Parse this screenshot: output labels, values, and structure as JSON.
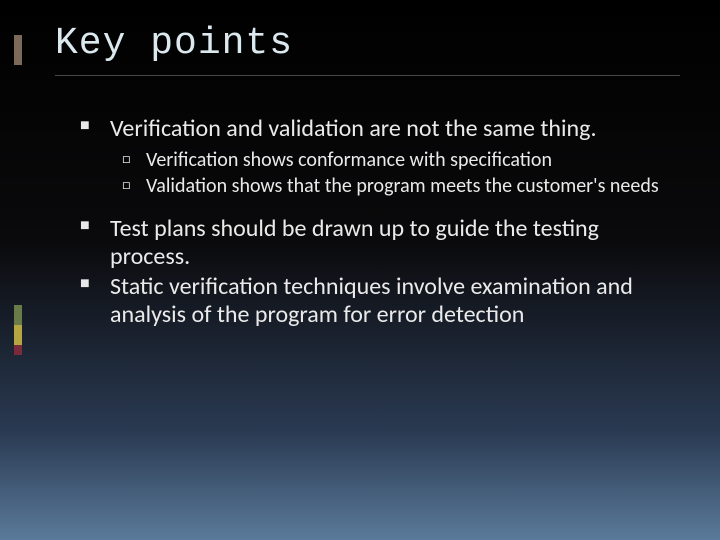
{
  "slide": {
    "title": "Key points",
    "bullets": {
      "b1": "Verification and validation are not the same thing.",
      "b1_sub": [
        "Verification shows conformance with specification",
        "Validation shows that the program meets the customer's needs"
      ],
      "b2": "Test plans should be drawn up to guide the testing process.",
      "b3": "Static verification techniques involve examination and analysis of the program for error detection"
    }
  }
}
